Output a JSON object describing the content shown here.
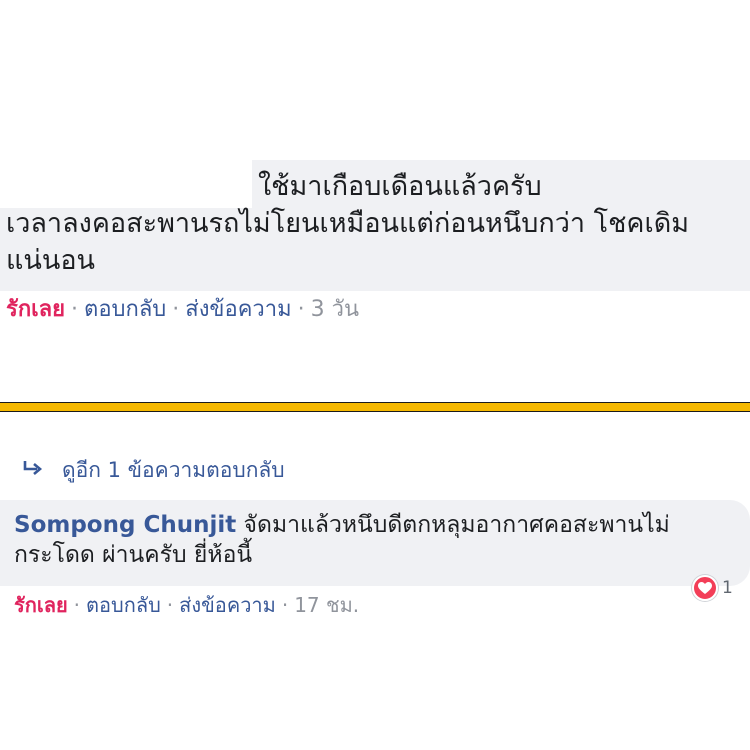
{
  "comment1": {
    "line1": "ใช้มาเกือบเดือนแล้วครับ",
    "line2": "เวลาลงคอสะพานรถไม่โยนเหมือนแต่ก่อนหนึบกว่า โชคเดิม",
    "line3": "แน่นอน",
    "actions": {
      "love": "รักเลย",
      "reply": "ตอบกลับ",
      "message": "ส่งข้อความ",
      "time": "3 วัน"
    }
  },
  "thread": {
    "see_more": "ดูอีก 1 ข้อความตอบกลับ"
  },
  "comment2": {
    "author": "Sompong Chunjit",
    "text": "จัดมาแล้วหนึบดีตกหลุมอากาศคอสะพานไม่กระโดด ผ่านครับ ยี่ห้อนี้",
    "reaction_count": "1",
    "actions": {
      "love": "รักเลย",
      "reply": "ตอบกลับ",
      "message": "ส่งข้อความ",
      "time": "17 ชม."
    }
  },
  "colors": {
    "divider": "#f5b800",
    "love": "#e0245e",
    "link": "#385898",
    "bubble": "#f0f1f4",
    "heart": "#f33e58"
  },
  "icons": {
    "reply_arrow": "reply-arrow-icon",
    "reaction": "heart-icon"
  }
}
